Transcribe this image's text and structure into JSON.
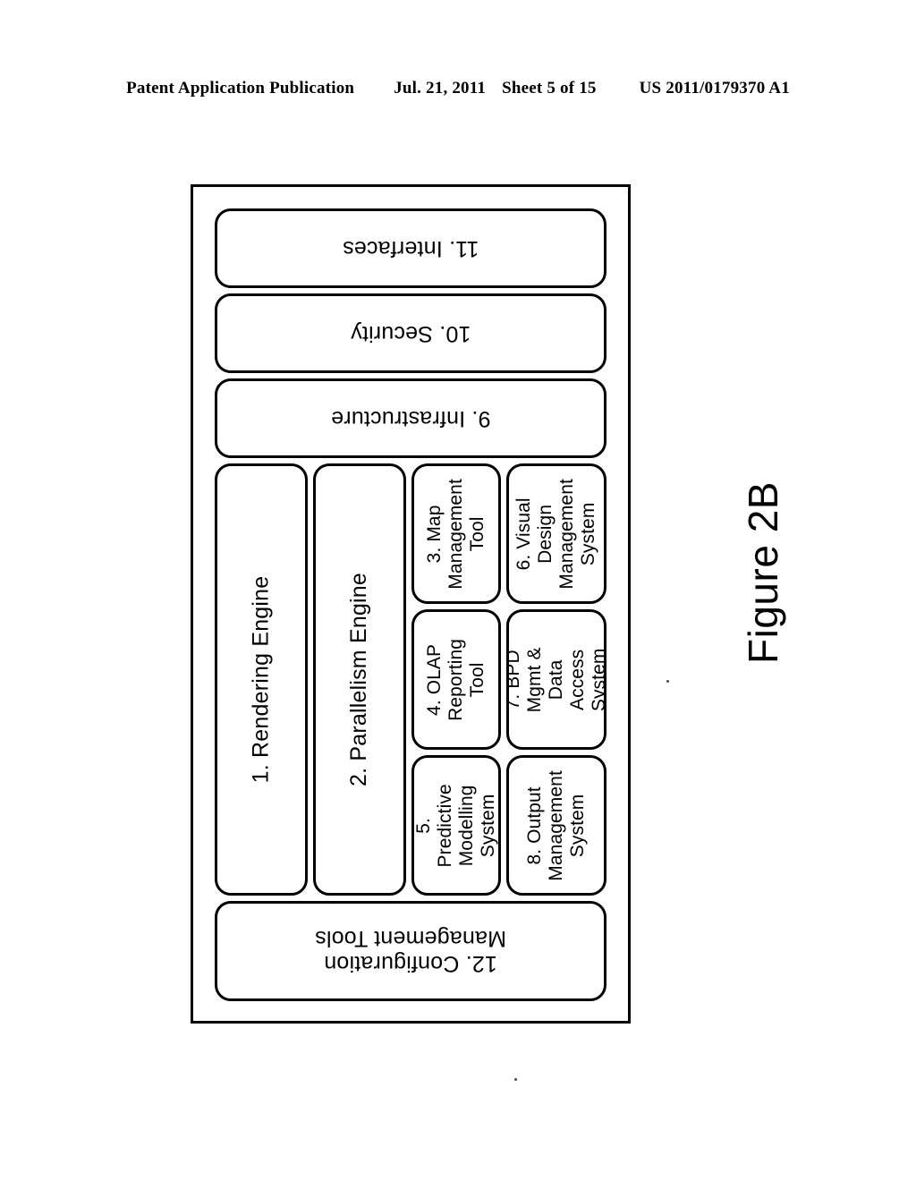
{
  "header": {
    "publication": "Patent Application Publication",
    "date": "Jul. 21, 2011",
    "sheet": "Sheet 5 of 15",
    "patent_number": "US 2011/0179370 A1"
  },
  "figure": {
    "caption": "Figure 2B",
    "banners": [
      {
        "id": "interfaces",
        "label": "11. Interfaces"
      },
      {
        "id": "security",
        "label": "10. Security"
      },
      {
        "id": "infrastructure",
        "label": "9. Infrastructure"
      }
    ],
    "engines": [
      {
        "id": "rendering-engine",
        "label": "1. Rendering Engine"
      },
      {
        "id": "parallelism-engine",
        "label": "2. Parallelism Engine"
      }
    ],
    "column_a": [
      {
        "id": "map-management-tool",
        "label": "3. Map\nManagement\nTool"
      },
      {
        "id": "olap-reporting-tool",
        "label": "4. OLAP\nReporting\nTool"
      },
      {
        "id": "predictive-modelling-system",
        "label": "5. Predictive\nModelling\nSystem"
      }
    ],
    "column_b": [
      {
        "id": "visual-design-management-system",
        "label": "6. Visual\nDesign\nManagement\nSystem"
      },
      {
        "id": "bpd-mgmt-data-access-system",
        "label": "7. BPD\nMgmt & Data\nAccess\nSystem"
      },
      {
        "id": "output-management-system",
        "label": "8. Output\nManagement\nSystem"
      }
    ],
    "footer_box": {
      "id": "configuration-management-tools",
      "label": "12. Configuration\nManagement Tools"
    }
  },
  "colors": {
    "ink": "#000000",
    "page": "#ffffff"
  }
}
